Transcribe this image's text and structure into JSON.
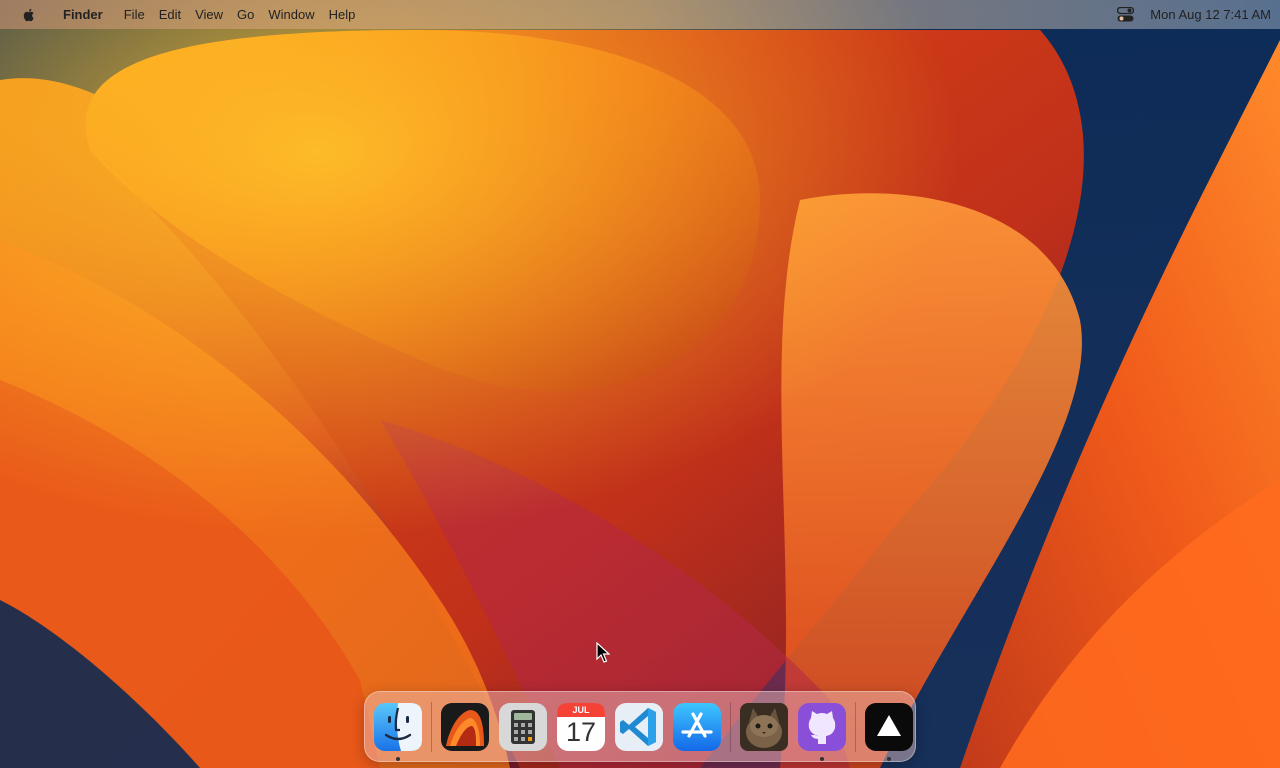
{
  "menubar": {
    "apple_icon": "apple-logo-icon",
    "app_name": "Finder",
    "items": [
      "File",
      "Edit",
      "View",
      "Go",
      "Window",
      "Help"
    ],
    "control_center_icon": "control-center-icon",
    "clock": "Mon Aug 12  7:41 AM"
  },
  "dock": {
    "items": [
      {
        "name": "Finder",
        "icon": "finder-icon",
        "running": true
      },
      {
        "name": "macOS Ventura",
        "icon": "ventura-icon",
        "running": false
      },
      {
        "name": "Calculator",
        "icon": "calculator-icon",
        "running": false
      },
      {
        "name": "Calendar",
        "icon": "calendar-icon",
        "running": false,
        "month": "JUL",
        "day": "17"
      },
      {
        "name": "Visual Studio Code",
        "icon": "vscode-icon",
        "running": false
      },
      {
        "name": "App Store",
        "icon": "app-store-icon",
        "running": false
      },
      {
        "name": "Cat Photo",
        "icon": "cat-photo-icon",
        "running": false
      },
      {
        "name": "GitHub Desktop",
        "icon": "github-icon",
        "running": true
      },
      {
        "name": "Terminal App",
        "icon": "triangle-app-icon",
        "running": true
      }
    ]
  },
  "colors": {
    "wallpaper_orange": "#f07a1a",
    "wallpaper_red": "#c8321e",
    "wallpaper_navy": "#0e2c58"
  }
}
